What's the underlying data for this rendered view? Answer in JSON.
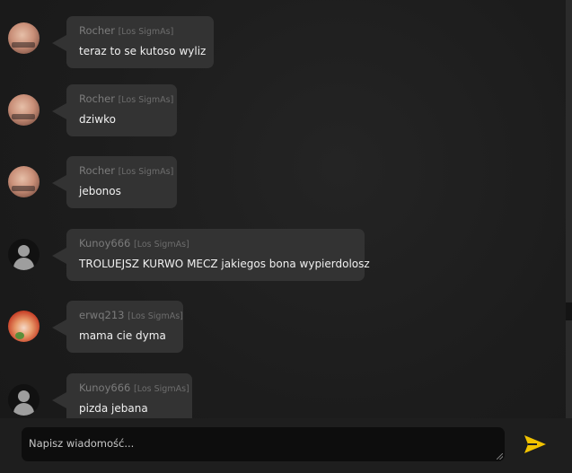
{
  "messages": [
    {
      "author": "Rocher",
      "team": "[Los SigmAs]",
      "text": "teraz to se kutoso wyliz",
      "avatar": "avatar-photo"
    },
    {
      "author": "Rocher",
      "team": "[Los SigmAs]",
      "text": "dziwko",
      "avatar": "avatar-photo"
    },
    {
      "author": "Rocher",
      "team": "[Los SigmAs]",
      "text": "jebonos",
      "avatar": "avatar-photo"
    },
    {
      "author": "Kunoy666",
      "team": "[Los SigmAs]",
      "text": "TROLUEJSZ KURWO MECZ jakiegos bona wypierdolosz",
      "avatar": "default-user-icon"
    },
    {
      "author": "erwq213",
      "team": "[Los SigmAs]",
      "text": "mama cie dyma",
      "avatar": "avatar-anime"
    },
    {
      "author": "Kunoy666",
      "team": "[Los SigmAs]",
      "text": "pizda jebana",
      "avatar": "default-user-icon"
    }
  ],
  "composer": {
    "placeholder": "Napisz wiadomość...",
    "send_icon": "send-icon",
    "accent_color": "#f2c300"
  }
}
